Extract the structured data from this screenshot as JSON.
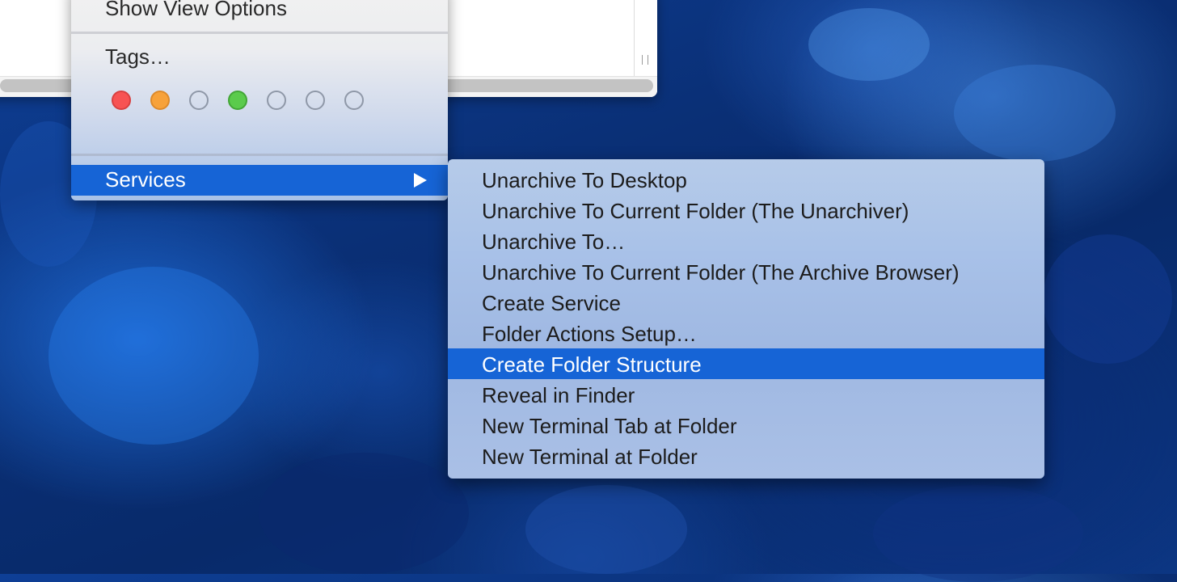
{
  "context_menu": {
    "show_view_options_label": "Show View Options",
    "tags_label": "Tags…",
    "tag_colors": [
      {
        "name": "red",
        "fill": "#f75353",
        "border": "#d84040"
      },
      {
        "name": "orange",
        "fill": "#f7a23a",
        "border": "#dd8a2a"
      },
      {
        "name": "none",
        "fill": "none",
        "border": "#8f98a8"
      },
      {
        "name": "green",
        "fill": "#5bcb4c",
        "border": "#43a637"
      },
      {
        "name": "none",
        "fill": "none",
        "border": "#8f98a8"
      },
      {
        "name": "none",
        "fill": "none",
        "border": "#8f98a8"
      },
      {
        "name": "none",
        "fill": "none",
        "border": "#8f98a8"
      }
    ],
    "services_label": "Services",
    "services_arrow_icon": "triangle-right-icon"
  },
  "services_submenu": {
    "items": [
      {
        "label": "Unarchive To Desktop",
        "highlighted": false
      },
      {
        "label": "Unarchive To Current Folder (The Unarchiver)",
        "highlighted": false
      },
      {
        "label": "Unarchive To…",
        "highlighted": false
      },
      {
        "label": "Unarchive To Current Folder (The Archive Browser)",
        "highlighted": false
      },
      {
        "label": "Create Service",
        "highlighted": false
      },
      {
        "label": "Folder Actions Setup…",
        "highlighted": false
      },
      {
        "label": "Create Folder Structure",
        "highlighted": true
      },
      {
        "label": "Reveal in Finder",
        "highlighted": false
      },
      {
        "label": "New Terminal Tab at Folder",
        "highlighted": false
      },
      {
        "label": "New Terminal at Folder",
        "highlighted": false
      }
    ]
  },
  "colors": {
    "highlight": "#1664d6",
    "desktop_base": "#0a2f75"
  }
}
